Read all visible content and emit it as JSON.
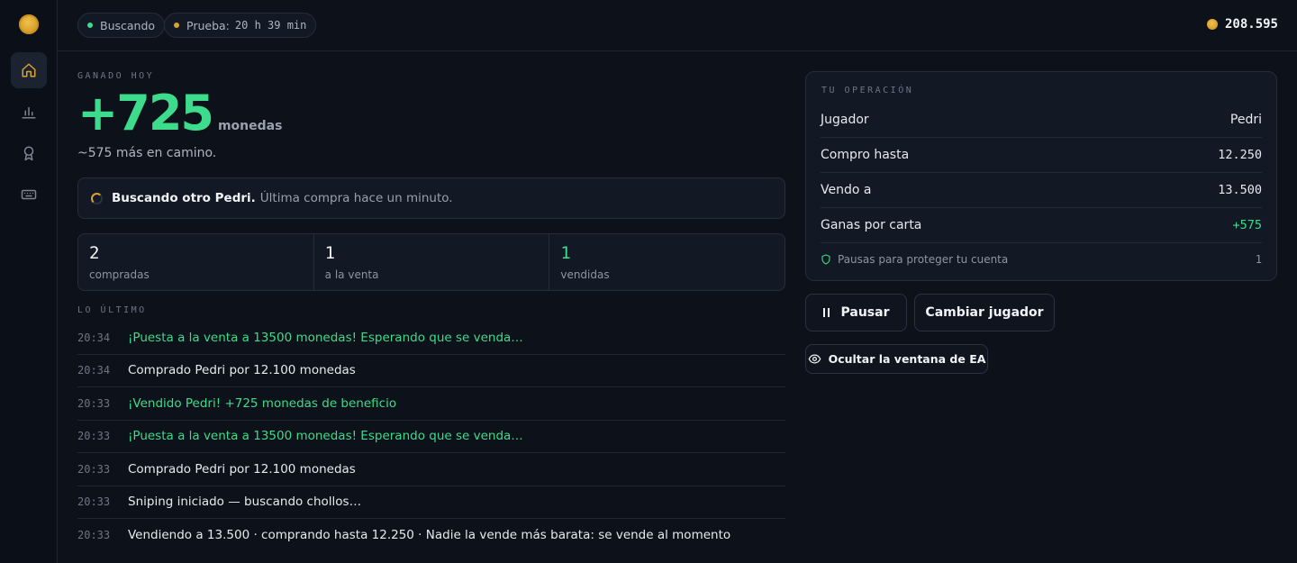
{
  "sidebar": {
    "items": [
      {
        "name": "home",
        "active": true
      },
      {
        "name": "stats",
        "active": false
      },
      {
        "name": "achievements",
        "active": false
      },
      {
        "name": "keyboard",
        "active": false
      }
    ]
  },
  "topbar": {
    "status_pill": "Buscando",
    "trial_label": "Prueba:",
    "trial_time": "20 h 39 min",
    "balance": "208.595",
    "colors": {
      "status_dot": "#3ddc8c",
      "trial_dot": "#d9a22c",
      "coin": "#d9a22c"
    }
  },
  "summary": {
    "label": "GANADO HOY",
    "amount": "+725",
    "unit": "monedas",
    "pending": "~575 más en camino."
  },
  "status": {
    "strong": "Buscando otro Pedri.",
    "detail": "Última compra hace un minuto."
  },
  "stats": [
    {
      "value": "2",
      "label": "compradas"
    },
    {
      "value": "1",
      "label": "a la venta"
    },
    {
      "value": "1",
      "label": "vendidas"
    }
  ],
  "log": {
    "label": "LO ÚLTIMO",
    "entries": [
      {
        "time": "20:34",
        "text": "¡Puesta a la venta a 13500 monedas! Esperando que se venda…",
        "highlight": true
      },
      {
        "time": "20:34",
        "text": "Comprado Pedri por 12.100 monedas",
        "highlight": false
      },
      {
        "time": "20:33",
        "text": "¡Vendido Pedri! +725 monedas de beneficio",
        "highlight": true
      },
      {
        "time": "20:33",
        "text": "¡Puesta a la venta a 13500 monedas! Esperando que se venda…",
        "highlight": true
      },
      {
        "time": "20:33",
        "text": "Comprado Pedri por 12.100 monedas",
        "highlight": false
      },
      {
        "time": "20:33",
        "text": "Sniping iniciado — buscando chollos…",
        "highlight": false
      },
      {
        "time": "20:33",
        "text": "Vendiendo a 13.500 · comprando hasta 12.250 · Nadie la vende más barata: se vende al momento",
        "highlight": false
      }
    ]
  },
  "operation": {
    "title": "TU OPERACIÓN",
    "player_label": "Jugador",
    "player_value": "Pedri",
    "buy_label": "Compro hasta",
    "buy_value": "12.250",
    "sell_label": "Vendo a",
    "sell_value": "13.500",
    "profit_label": "Ganas por carta",
    "profit_value": "+575",
    "pauses_label": "Pausas para proteger tu cuenta",
    "pauses_value": "1"
  },
  "actions": {
    "pause": "Pausar",
    "change_player": "Cambiar jugador",
    "hide_window": "Ocultar la ventana de EA"
  },
  "accent": {
    "green": "#3ddc8c",
    "gold": "#d9a22c"
  }
}
